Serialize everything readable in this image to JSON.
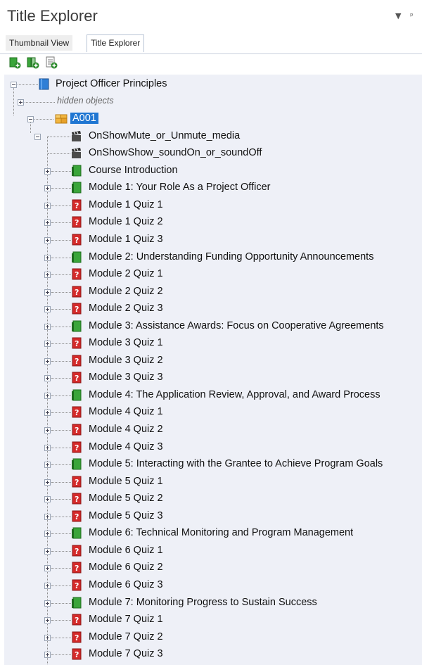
{
  "panel": {
    "title": "Title Explorer",
    "dropdown_glyph": "▼",
    "pin_glyph": "ᵖ"
  },
  "tabs": [
    {
      "label": "Thumbnail View",
      "active": false
    },
    {
      "label": "Title Explorer",
      "active": true
    }
  ],
  "toolbar": [
    {
      "icon": "add-green-icon"
    },
    {
      "icon": "add-chapter-icon"
    },
    {
      "icon": "add-page-icon"
    }
  ],
  "tree": {
    "root": {
      "label": "Project Officer Principles",
      "icon": "book-icon"
    },
    "hidden": {
      "label": "hidden objects"
    },
    "folder": {
      "label": "A001",
      "icon": "folder-icon"
    },
    "actions": [
      {
        "label": "OnShowMute_or_Unmute_media",
        "icon": "clapper-icon"
      },
      {
        "label": "OnShowShow_soundOn_or_soundOff",
        "icon": "clapper-icon"
      }
    ],
    "items": [
      {
        "label": "Course Introduction",
        "type": "page"
      },
      {
        "label": "Module 1: Your Role As a Project Officer",
        "type": "page"
      },
      {
        "label": "Module 1 Quiz 1",
        "type": "quiz"
      },
      {
        "label": "Module 1 Quiz 2",
        "type": "quiz"
      },
      {
        "label": "Module 1 Quiz 3",
        "type": "quiz"
      },
      {
        "label": "Module 2: Understanding Funding Opportunity Announcements",
        "type": "page"
      },
      {
        "label": "Module 2 Quiz 1",
        "type": "quiz"
      },
      {
        "label": "Module 2 Quiz 2",
        "type": "quiz"
      },
      {
        "label": "Module 2 Quiz 3",
        "type": "quiz"
      },
      {
        "label": "Module 3: Assistance Awards: Focus on Cooperative Agreements",
        "type": "page"
      },
      {
        "label": "Module 3 Quiz 1",
        "type": "quiz"
      },
      {
        "label": "Module 3 Quiz 2",
        "type": "quiz"
      },
      {
        "label": "Module 3 Quiz 3",
        "type": "quiz"
      },
      {
        "label": "Module 4: The Application Review, Approval, and Award Process",
        "type": "page"
      },
      {
        "label": "Module 4 Quiz 1",
        "type": "quiz"
      },
      {
        "label": "Module 4 Quiz 2",
        "type": "quiz"
      },
      {
        "label": "Module 4 Quiz 3",
        "type": "quiz"
      },
      {
        "label": "Module 5: Interacting with the Grantee to Achieve Program Goals",
        "type": "page"
      },
      {
        "label": "Module 5 Quiz 1",
        "type": "quiz"
      },
      {
        "label": "Module 5 Quiz 2",
        "type": "quiz"
      },
      {
        "label": "Module 5 Quiz 3",
        "type": "quiz"
      },
      {
        "label": "Module 6: Technical Monitoring and Program Management",
        "type": "page"
      },
      {
        "label": "Module 6 Quiz 1",
        "type": "quiz"
      },
      {
        "label": "Module 6 Quiz 2",
        "type": "quiz"
      },
      {
        "label": "Module 6 Quiz 3",
        "type": "quiz"
      },
      {
        "label": "Module 7: Monitoring Progress to Sustain Success",
        "type": "page"
      },
      {
        "label": "Module 7 Quiz 1",
        "type": "quiz"
      },
      {
        "label": "Module 7 Quiz 2",
        "type": "quiz"
      },
      {
        "label": "Module 7 Quiz 3",
        "type": "quiz"
      },
      {
        "label": "",
        "type": "page"
      }
    ]
  },
  "colors": {
    "selection": "#1f76d2",
    "tree_bg": "#eef0f7",
    "page_green": "#3aa53a",
    "quiz_red": "#d42a2a"
  }
}
